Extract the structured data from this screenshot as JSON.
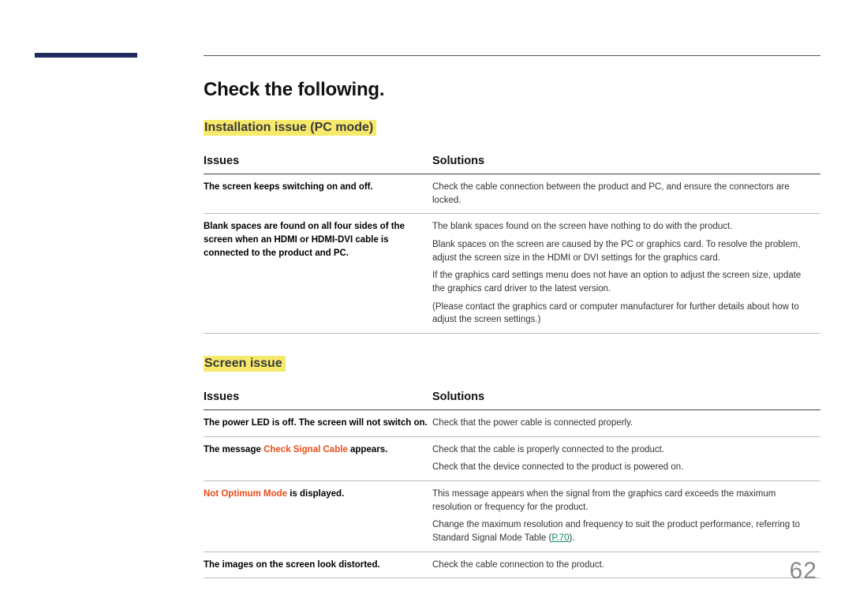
{
  "title": "Check the following.",
  "page_number": "62",
  "sections": [
    {
      "heading": "Installation issue (PC mode)",
      "columns": {
        "issues": "Issues",
        "solutions": "Solutions"
      },
      "rows": [
        {
          "issue_plain": "The screen keeps switching on and off.",
          "solution_paras": [
            "Check the cable connection between the product and PC, and ensure the connectors are locked."
          ]
        },
        {
          "issue_plain": "Blank spaces are found on all four sides of the screen when an HDMI or HDMI-DVI cable is connected to the product and PC.",
          "solution_paras": [
            "The blank spaces found on the screen have nothing to do with the product.",
            "Blank spaces on the screen are caused by the PC or graphics card. To resolve the problem, adjust the screen size in the HDMI or DVI settings for the graphics card.",
            "If the graphics card settings menu does not have an option to adjust the screen size, update the graphics card driver to the latest version.",
            "(Please contact the graphics card or computer manufacturer for further details about how to adjust the screen settings.)"
          ]
        }
      ]
    },
    {
      "heading": "Screen issue",
      "columns": {
        "issues": "Issues",
        "solutions": "Solutions"
      },
      "rows": [
        {
          "issue_plain": "The power LED is off. The screen will not switch on.",
          "solution_paras": [
            "Check that the power cable is connected properly."
          ]
        },
        {
          "issue_pre": "The message ",
          "issue_red": "Check Signal Cable",
          "issue_post": " appears.",
          "solution_paras": [
            "Check that the cable is properly connected to the product.",
            "Check that the device connected to the product is powered on."
          ]
        },
        {
          "issue_red": "Not Optimum Mode",
          "issue_post": " is displayed.",
          "solution_paras_linked": {
            "p1": "This message appears when the signal from the graphics card exceeds the maximum resolution or frequency for the product.",
            "p2_pre": "Change the maximum resolution and frequency to suit the product performance, referring to Standard Signal Mode Table (",
            "p2_link": "P.70",
            "p2_post": ")."
          }
        },
        {
          "issue_plain": "The images on the screen look distorted.",
          "solution_paras": [
            "Check the cable connection to the product."
          ]
        }
      ]
    }
  ]
}
